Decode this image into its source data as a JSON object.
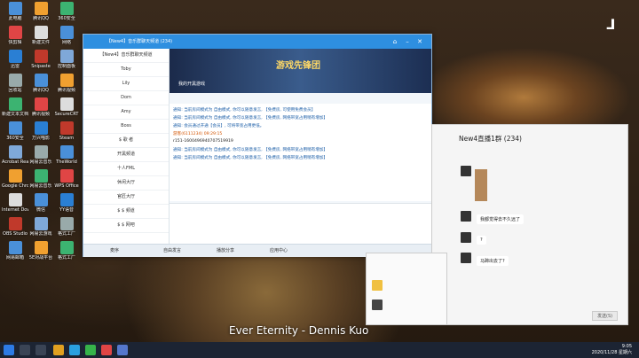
{
  "desktop": {
    "icons": [
      {
        "label": "此电脑"
      },
      {
        "label": "腾讯QQ"
      },
      {
        "label": "360安全"
      },
      {
        "label": "快剪辑"
      },
      {
        "label": "新建文件"
      },
      {
        "label": "网络"
      },
      {
        "label": "迅雷"
      },
      {
        "label": "Snipaste"
      },
      {
        "label": "控制面板"
      },
      {
        "label": "回收站"
      },
      {
        "label": "腾讯QQ"
      },
      {
        "label": "腾讯视频"
      },
      {
        "label": "新建文本文档"
      },
      {
        "label": "腾讯视频"
      },
      {
        "label": "SecureCRT"
      },
      {
        "label": "360安全"
      },
      {
        "label": "万兴喵影"
      },
      {
        "label": "Steam"
      },
      {
        "label": "Acrobat Reader DC"
      },
      {
        "label": "网易云音乐"
      },
      {
        "label": "TheWorld"
      },
      {
        "label": "Google Chrome"
      },
      {
        "label": "网易云音乐"
      },
      {
        "label": "WPS Office"
      },
      {
        "label": "Internet Downlo..."
      },
      {
        "label": "微信"
      },
      {
        "label": "YY语音"
      },
      {
        "label": "OBS Studio"
      },
      {
        "label": "网易云游戏"
      },
      {
        "label": "格式工厂"
      },
      {
        "label": "网易邮箱"
      },
      {
        "label": "5E对战平台"
      },
      {
        "label": "格式工厂"
      }
    ]
  },
  "qqwin": {
    "title": "【New4】音乐群聊天频道 (234)",
    "sidebar": [
      "【New4】音乐群聊天频道",
      "Toby",
      "Lily",
      "Dom",
      "Amy",
      "Boss",
      "$ 歌 者",
      "开黑频道",
      "十人FML",
      "休闲大厅",
      "官匠大厅",
      "$ $ 频道",
      "$ $ 网吧"
    ],
    "banner_text": "游戏先锋团",
    "banner_sub": "我的开黑游戏",
    "messages": [
      "通知: 当前房间模式为 自由模式, 你可以随意发言, 【免费房, 可使用免费会员】",
      "通知: 当前房间模式为 自由模式, 你可以随意发言, 【免费房, 网络带宽占用稍有增加】",
      "通知: 会员通过开通【会员】, 可将带宽占用更低。",
      "游客(6111234) 09:29:15",
      "r151-1600496940707519919",
      "通知: 当前房间模式为 自由模式, 你可以随意发言, 【免费房, 网络带宽占用稍有增加】",
      "通知: 当前房间模式为 自由模式, 你可以随意发言, 【免费房, 网络带宽占用稍有增加】"
    ],
    "bottom": [
      "麦序",
      "自由发言",
      "播放分享",
      "应用中心"
    ]
  },
  "group": {
    "title": "New4直播1群 (234)",
    "bubbles": [
      "我都觉得去不久远了",
      "?",
      "马蹄出去了?"
    ],
    "send": "发送(S)"
  },
  "caption": "Ever Eternity - Dennis Kuo",
  "clock": {
    "time": "9:05",
    "date": "2020/11/28 星期六"
  }
}
